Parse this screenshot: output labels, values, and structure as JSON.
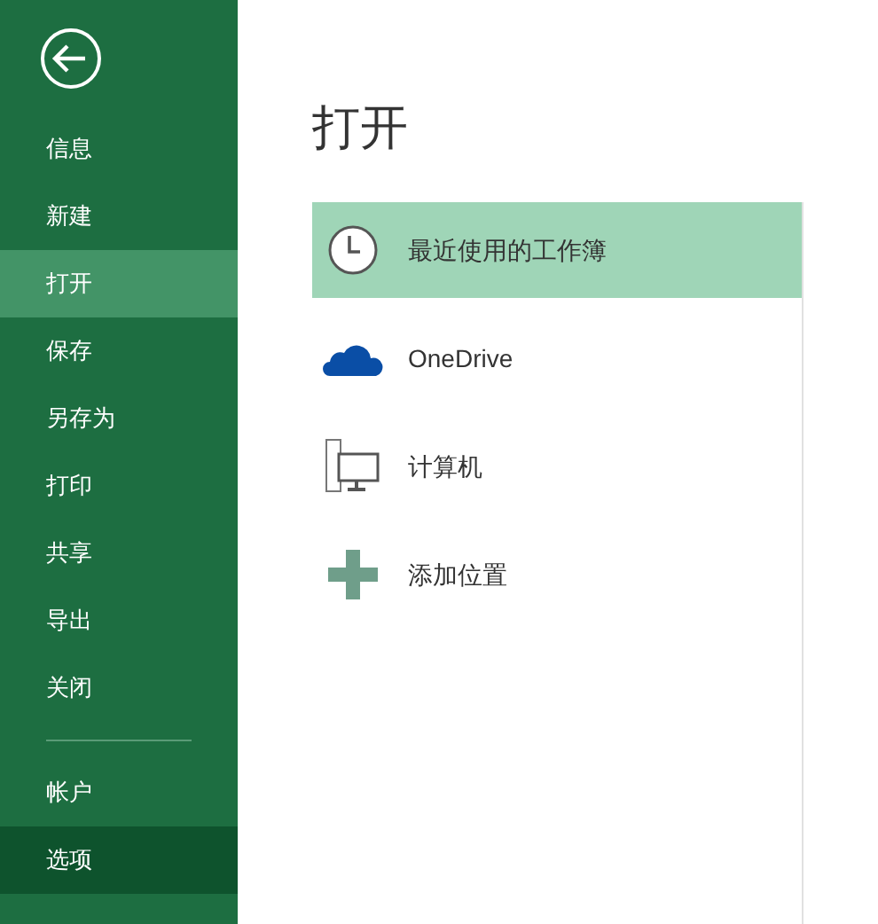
{
  "sidebar": {
    "items": [
      {
        "label": "信息",
        "selected": false,
        "hovered": false
      },
      {
        "label": "新建",
        "selected": false,
        "hovered": false
      },
      {
        "label": "打开",
        "selected": true,
        "hovered": false
      },
      {
        "label": "保存",
        "selected": false,
        "hovered": false
      },
      {
        "label": "另存为",
        "selected": false,
        "hovered": false
      },
      {
        "label": "打印",
        "selected": false,
        "hovered": false
      },
      {
        "label": "共享",
        "selected": false,
        "hovered": false
      },
      {
        "label": "导出",
        "selected": false,
        "hovered": false
      },
      {
        "label": "关闭",
        "selected": false,
        "hovered": false
      }
    ],
    "bottom_items": [
      {
        "label": "帐户",
        "selected": false,
        "hovered": false
      },
      {
        "label": "选项",
        "selected": false,
        "hovered": true
      }
    ]
  },
  "page": {
    "title": "打开",
    "places": [
      {
        "kind": "recent",
        "label": "最近使用的工作簿",
        "selected": true
      },
      {
        "kind": "cloud",
        "label": "OneDrive",
        "selected": false
      },
      {
        "kind": "computer",
        "label": "计算机",
        "selected": false
      },
      {
        "kind": "add",
        "label": "添加位置",
        "selected": false
      }
    ]
  }
}
